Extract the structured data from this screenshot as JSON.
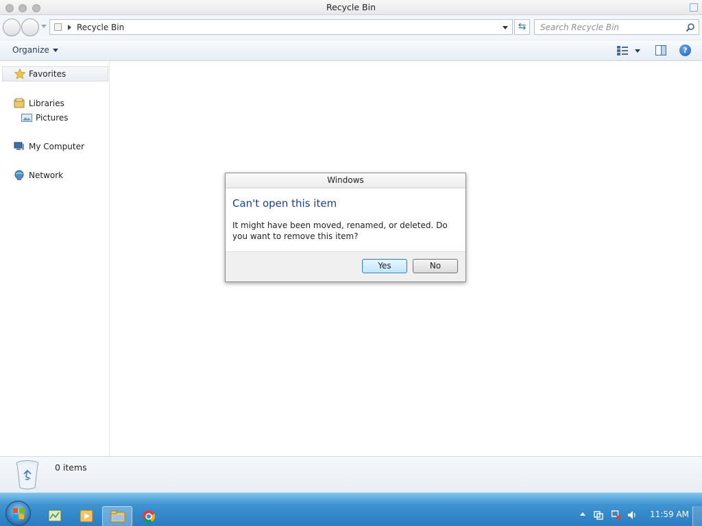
{
  "window": {
    "title": "Recycle Bin"
  },
  "address": {
    "path_item": "Recycle Bin",
    "search_placeholder": "Search Recycle Bin"
  },
  "toolbar": {
    "organize_label": "Organize"
  },
  "nav": {
    "favorites": "Favorites",
    "libraries": "Libraries",
    "pictures": "Pictures",
    "computer": "My Computer",
    "network": "Network"
  },
  "details": {
    "item_count": "0 items"
  },
  "dialog": {
    "title": "Windows",
    "heading": "Can't open this item",
    "message": "It might have been moved, renamed, or deleted. Do you want to remove this item?",
    "yes_label": "Yes",
    "no_label": "No"
  },
  "taskbar": {
    "clock": "11:59 AM",
    "apps": [
      "task-manager",
      "media-player",
      "windows-explorer",
      "chrome"
    ]
  },
  "colors": {
    "dialog_heading": "#1e3f8a",
    "taskbar": "#2a7cc2",
    "default_button_border": "#3c7fb1"
  }
}
